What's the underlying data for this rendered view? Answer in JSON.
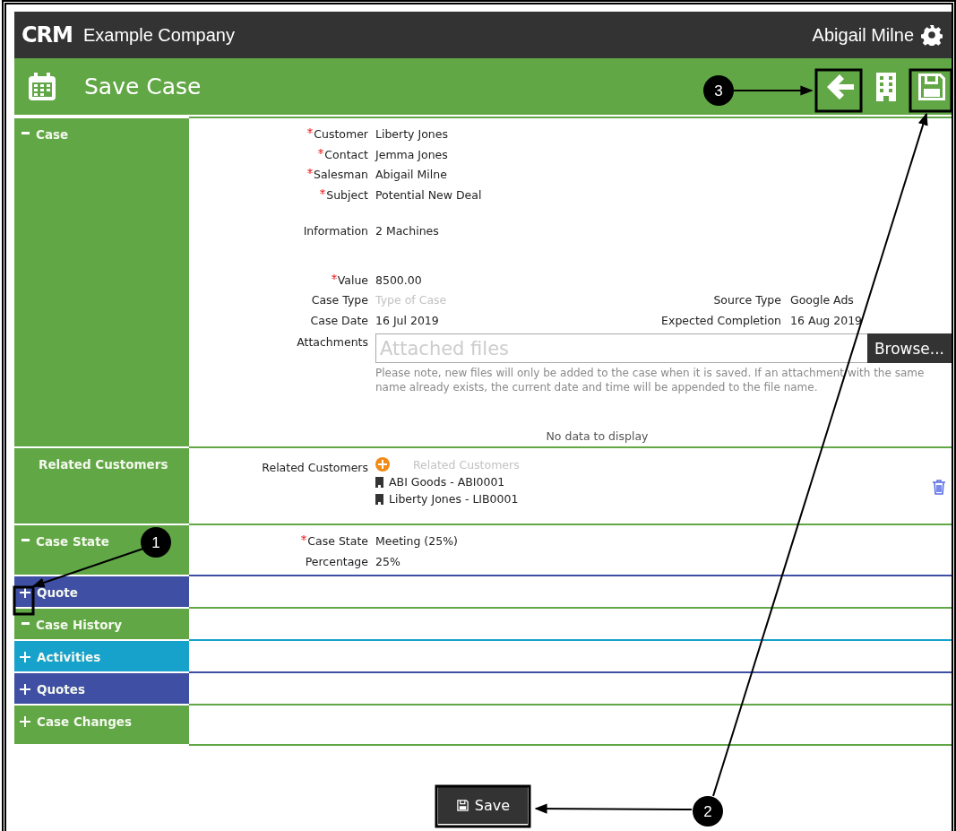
{
  "header": {
    "logo": "CRM",
    "company": "Example Company",
    "user": "Abigail Milne"
  },
  "toolbar": {
    "title": "Save Case"
  },
  "sections": [
    {
      "title": "Case",
      "kind": "case",
      "expanded": true,
      "color": "#62a746"
    },
    {
      "title": "Related Customers",
      "kind": "related",
      "color": "#62a746"
    },
    {
      "title": "Case State",
      "kind": "state",
      "expanded": true,
      "color": "#62a746"
    },
    {
      "title": "Quote",
      "kind": "empty",
      "expanded": false,
      "color": "#3f4fa3"
    },
    {
      "title": "Case History",
      "kind": "empty",
      "expanded": true,
      "color": "#62a746"
    },
    {
      "title": "Activities",
      "kind": "empty",
      "expanded": false,
      "color": "#17a2cc"
    },
    {
      "title": "Quotes",
      "kind": "empty",
      "expanded": false,
      "color": "#3f4fa3"
    },
    {
      "title": "Case Changes",
      "kind": "empty",
      "expanded": false,
      "color": "#62a746"
    }
  ],
  "case": {
    "groups": [
      [
        {
          "label": "Customer",
          "required": true,
          "value": "Liberty Jones"
        },
        {
          "label": "Contact",
          "required": true,
          "value": "Jemma Jones"
        },
        {
          "label": "Salesman",
          "required": true,
          "value": "Abigail Milne"
        },
        {
          "label": "Subject",
          "required": true,
          "value": "Potential New Deal"
        }
      ],
      [
        {
          "label": "Information",
          "required": false,
          "value": "2 Machines"
        }
      ],
      [
        {
          "label": "Value",
          "required": true,
          "value": "8500.00"
        },
        {
          "label": "Case Type",
          "required": false,
          "placeholder": "Type of Case",
          "right_label": "Source Type",
          "right_value": "Google Ads"
        },
        {
          "label": "Case Date",
          "required": false,
          "value": "16 Jul 2019",
          "right_label": "Expected Completion",
          "right_value": "16 Aug 2019"
        }
      ]
    ],
    "attachments": {
      "label": "Attachments",
      "placeholder": "Attached files",
      "button": "Browse...",
      "note": "Please note, new files will only be added to the case when it is saved. If an attachment with the same name already exists, the current date and time will be appended to the file name."
    },
    "empty_text": "No data to display"
  },
  "related": {
    "label": "Related Customers",
    "placeholder": "Related Customers",
    "customers": [
      "ABI Goods - ABI0001",
      "Liberty Jones - LIB0001"
    ]
  },
  "state": {
    "fields": [
      {
        "label": "Case State",
        "required": true,
        "value": "Meeting (25%)"
      },
      {
        "label": "Percentage",
        "required": false,
        "value": "25%"
      }
    ]
  },
  "save_button": "Save",
  "annotations": [
    {
      "number": "1"
    },
    {
      "number": "2"
    },
    {
      "number": "3"
    }
  ]
}
